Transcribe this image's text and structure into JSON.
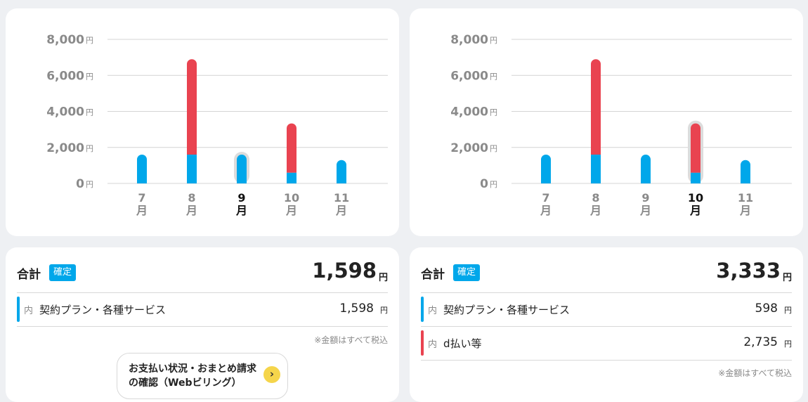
{
  "charts": [
    {
      "name": "chart-left",
      "selected_index": 2,
      "chart_data": {
        "type": "bar",
        "stacked": true,
        "categories": [
          [
            "7",
            "月"
          ],
          [
            "8",
            "月"
          ],
          [
            "9",
            "月"
          ],
          [
            "10",
            "月"
          ],
          [
            "11",
            "月"
          ]
        ],
        "series": [
          {
            "color": "#00a7ea",
            "values": [
              1600,
              1600,
              1598,
              598,
              1300
            ]
          },
          {
            "color": "#e94350",
            "values": [
              0,
              5300,
              0,
              2735,
              0
            ]
          }
        ],
        "ylim": [
          0,
          8000
        ],
        "yticks": [
          0,
          2000,
          4000,
          6000,
          8000
        ],
        "ytick_labels": [
          "0",
          "2,000",
          "4,000",
          "6,000",
          "8,000"
        ],
        "ytick_unit": "円",
        "grid": true
      }
    },
    {
      "name": "chart-right",
      "selected_index": 3,
      "chart_data": {
        "type": "bar",
        "stacked": true,
        "categories": [
          [
            "7",
            "月"
          ],
          [
            "8",
            "月"
          ],
          [
            "9",
            "月"
          ],
          [
            "10",
            "月"
          ],
          [
            "11",
            "月"
          ]
        ],
        "series": [
          {
            "color": "#00a7ea",
            "values": [
              1600,
              1600,
              1598,
              598,
              1300
            ]
          },
          {
            "color": "#e94350",
            "values": [
              0,
              5300,
              0,
              2735,
              0
            ]
          }
        ],
        "ylim": [
          0,
          8000
        ],
        "yticks": [
          0,
          2000,
          4000,
          6000,
          8000
        ],
        "ytick_labels": [
          "0",
          "2,000",
          "4,000",
          "6,000",
          "8,000"
        ],
        "ytick_unit": "円",
        "grid": true
      }
    }
  ],
  "left_total": {
    "label": "合計",
    "badge": "確定",
    "amount": "1,598",
    "unit": "円",
    "items": [
      {
        "prefix": "内",
        "label": "契約プラン・各種サービス",
        "amount": "1,598",
        "unit": "円",
        "color": "#00a7ea"
      }
    ],
    "note": "※金額はすべて税込",
    "web_button": {
      "line1": "お支払い状況・おまとめ請求",
      "line2": "の確認（Webビリング）",
      "icon": "chevron-right-icon"
    }
  },
  "right_total": {
    "label": "合計",
    "badge": "確定",
    "amount": "3,333",
    "unit": "円",
    "items": [
      {
        "prefix": "内",
        "label": "契約プラン・各種サービス",
        "amount": "598",
        "unit": "円",
        "color": "#00a7ea"
      },
      {
        "prefix": "内",
        "label": "d払い等",
        "amount": "2,735",
        "unit": "円",
        "color": "#e94350"
      }
    ],
    "note": "※金額はすべて税込"
  },
  "colors": {
    "accent": "#00a7ea",
    "red": "#e94350",
    "button_icon": "#f5d54b"
  }
}
